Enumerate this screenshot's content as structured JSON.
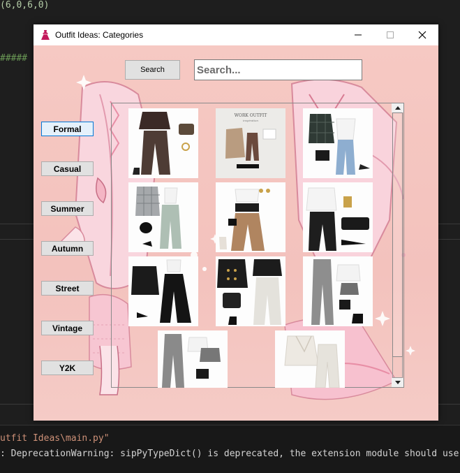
{
  "editor": {
    "code_top": "(6,0,6,0)",
    "code_hash": "#####"
  },
  "terminal": {
    "line1": "utfit Ideas\\main.py\"",
    "line2": ": DeprecationWarning: sipPyTypeDict() is deprecated, the extension module should use s"
  },
  "window": {
    "title": "Outfit Ideas: Categories",
    "app_icon": "dress-icon",
    "minimize_icon": "minimize-icon",
    "maximize_icon": "maximize-icon",
    "close_icon": "close-icon"
  },
  "toolbar": {
    "search_label": "Search",
    "search_placeholder": "Search..."
  },
  "categories": [
    {
      "label": "Formal",
      "active": true
    },
    {
      "label": "Casual",
      "active": false
    },
    {
      "label": "Summer",
      "active": false
    },
    {
      "label": "Autumn",
      "active": false
    },
    {
      "label": "Street",
      "active": false
    },
    {
      "label": "Vintage",
      "active": false
    },
    {
      "label": "Y2K",
      "active": false
    }
  ],
  "gallery": {
    "work_outfit_title": "WORK OUTFIT",
    "work_outfit_subtitle": "inspiration",
    "tiles": [
      {
        "name": "outfit-black-top-brown-trousers"
      },
      {
        "name": "outfit-work-outfit-flatlay"
      },
      {
        "name": "outfit-plaid-blazer-jeans"
      },
      {
        "name": "outfit-check-blazer-mint-trousers"
      },
      {
        "name": "outfit-corset-belt-wide-pants"
      },
      {
        "name": "outfit-white-blouse-black-trousers"
      },
      {
        "name": "outfit-black-blazer-wide-pants"
      },
      {
        "name": "outfit-double-breasted-blazer-white-pants"
      },
      {
        "name": "outfit-grey-vest-grey-trousers"
      },
      {
        "name": "outfit-grey-vest-trousers-partial"
      },
      {
        "name": "outfit-cream-wrap-blazer-set"
      }
    ]
  },
  "colors": {
    "background": "#f6c9c3",
    "active_border": "#0078d7",
    "button": "#e1e1e1"
  }
}
